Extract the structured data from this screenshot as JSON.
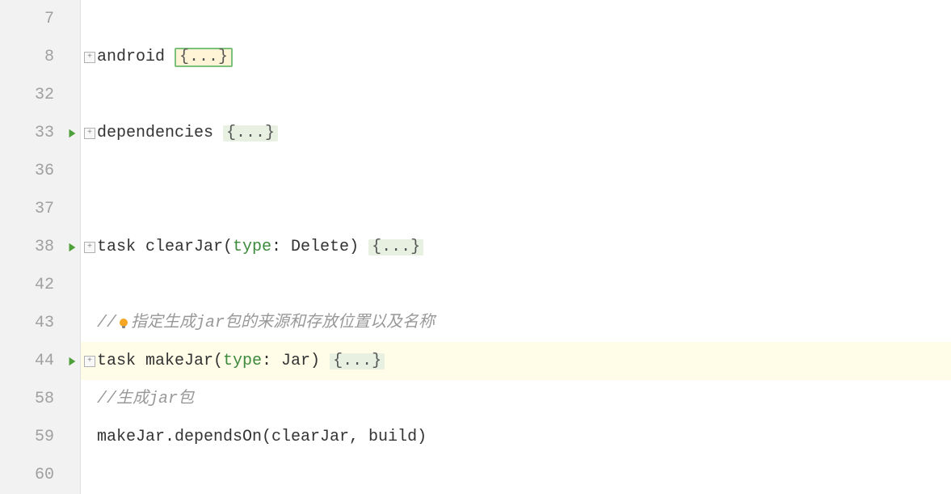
{
  "lines": {
    "l7": {
      "number": "7"
    },
    "l8": {
      "number": "8",
      "android": "android ",
      "fold_content": "{...}"
    },
    "l32": {
      "number": "32"
    },
    "l33": {
      "number": "33",
      "dependencies": "dependencies ",
      "fold_content": "{...}"
    },
    "l36": {
      "number": "36"
    },
    "l37": {
      "number": "37"
    },
    "l38": {
      "number": "38",
      "task_prefix": "task clearJar(",
      "type_kw": "type",
      "task_suffix": ": Delete) ",
      "fold_content": "{...}"
    },
    "l42": {
      "number": "42"
    },
    "l43": {
      "number": "43",
      "comment_prefix": "//",
      "comment_text": "指定生成jar包的来源和存放位置以及名称"
    },
    "l44": {
      "number": "44",
      "task_prefix": "task makeJar(",
      "type_kw": "type",
      "task_suffix": ": Jar) ",
      "fold_content": "{...}"
    },
    "l58": {
      "number": "58",
      "comment_prefix": "//",
      "comment_text": "生成jar包"
    },
    "l59": {
      "number": "59",
      "code": "makeJar.dependsOn(clearJar, build)"
    },
    "l60": {
      "number": "60"
    }
  },
  "icons": {
    "fold_plus": "+"
  }
}
